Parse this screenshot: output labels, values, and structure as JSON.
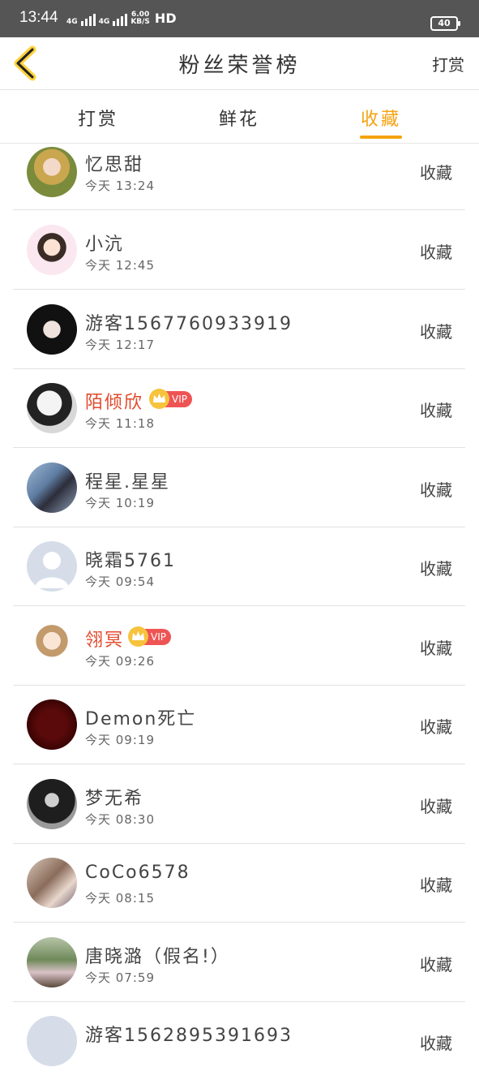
{
  "status_bar": {
    "time": "13:44",
    "net1": "4G",
    "net2": "4G",
    "speed_value": "6.00",
    "speed_unit": "KB/S",
    "hd": "HD",
    "battery": "40"
  },
  "header": {
    "title": "粉丝荣誉榜",
    "action": "打赏"
  },
  "tabs": [
    {
      "label": "打赏"
    },
    {
      "label": "鲜花"
    },
    {
      "label": "收藏",
      "active": true
    }
  ],
  "colors": {
    "accent": "#f5a310",
    "vip_name": "#e2492b",
    "vip_badge": "#ef5454"
  },
  "items": [
    {
      "name": "忆思甜",
      "time": "今天 13:24",
      "action": "收藏"
    },
    {
      "name": "小沆",
      "time": "今天 12:45",
      "action": "收藏"
    },
    {
      "name": "游客1567760933919",
      "time": "今天 12:17",
      "action": "收藏"
    },
    {
      "name": "陌倾欣",
      "time": "今天 11:18",
      "action": "收藏",
      "vip": "VIP"
    },
    {
      "name": "程星.星星",
      "time": "今天 10:19",
      "action": "收藏"
    },
    {
      "name": "晓霜5761",
      "time": "今天 09:54",
      "action": "收藏"
    },
    {
      "name": "翎冥",
      "time": "今天 09:26",
      "action": "收藏",
      "vip": "VIP"
    },
    {
      "name": "Demon死亡",
      "time": "今天 09:19",
      "action": "收藏"
    },
    {
      "name": "梦无希",
      "time": "今天 08:30",
      "action": "收藏"
    },
    {
      "name": "CoCo6578",
      "time": "今天 08:15",
      "action": "收藏"
    },
    {
      "name": "唐晓潞（假名!）",
      "time": "今天 07:59",
      "action": "收藏"
    },
    {
      "name": "游客1562895391693",
      "time": "",
      "action": "收藏"
    }
  ]
}
